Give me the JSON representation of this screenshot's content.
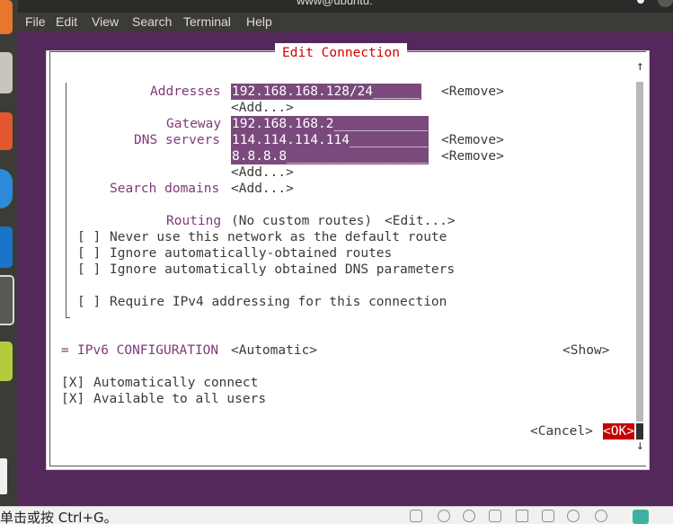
{
  "window": {
    "title": "www@ubuntu:"
  },
  "menubar": [
    "File",
    "Edit",
    "View",
    "Search",
    "Terminal",
    "Help"
  ],
  "dialog": {
    "title": "Edit Connection",
    "addresses": {
      "label": "Addresses",
      "value": "192.168.168.128/24",
      "pad": "______",
      "remove": "<Remove>"
    },
    "add_address": "<Add...>",
    "gateway": {
      "label": "Gateway",
      "value": "192.168.168.2",
      "pad": "____________"
    },
    "dns": {
      "label": "DNS servers",
      "entries": [
        {
          "value": "114.114.114.114",
          "pad": "__________",
          "remove": "<Remove>"
        },
        {
          "value": "8.8.8.8",
          "pad": "__________________",
          "remove": "<Remove>"
        }
      ],
      "add": "<Add...>"
    },
    "search_domains": {
      "label": "Search domains",
      "add": "<Add...>"
    },
    "routing": {
      "label": "Routing",
      "value": "(No custom routes)",
      "edit": "<Edit...>"
    },
    "checkboxes": [
      {
        "box": "[ ]",
        "text": "Never use this network as the default route"
      },
      {
        "box": "[ ]",
        "text": "Ignore automatically-obtained routes"
      },
      {
        "box": "[ ]",
        "text": "Ignore automatically obtained DNS parameters"
      },
      {
        "box": "[ ]",
        "text": "Require IPv4 addressing for this connection"
      }
    ],
    "ipv6": {
      "marker": "=",
      "label": "IPv6 CONFIGURATION",
      "mode": "<Automatic>",
      "show": "<Show>"
    },
    "options": [
      {
        "box": "[X]",
        "text": "Automatically connect"
      },
      {
        "box": "[X]",
        "text": "Available to all users"
      }
    ],
    "cancel": "<Cancel>",
    "ok": "<OK>",
    "scroll_up": "↑",
    "scroll_down": "↓"
  },
  "statusbar": {
    "text": "单击或按 Ctrl+G。"
  },
  "colors": {
    "terminal_bg": "#55285b",
    "field_bg": "#7a4a7d",
    "label": "#803a7a",
    "ok_bg": "#c50000",
    "title_red": "#d00000"
  }
}
